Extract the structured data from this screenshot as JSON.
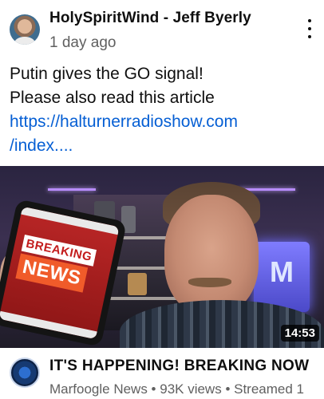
{
  "post": {
    "author": "HolySpiritWind - Jeff Byerly",
    "time_ago": "1 day ago",
    "text_line1": "Putin gives the GO signal!",
    "text_line2": "Please also read this article",
    "link_line1": "https://halturnerradioshow.com",
    "link_line2": "/index...."
  },
  "icons": {
    "more": "more-vert-icon",
    "avatar": "author-avatar",
    "channel_avatar": "channel-avatar"
  },
  "video": {
    "thumbnail_text_top": "BREAKING",
    "thumbnail_text_bottom": "NEWS",
    "panel_letter": "M",
    "duration": "14:53",
    "title": "IT'S HAPPENING! BREAKING NOW",
    "channel": "Marfoogle News",
    "views": "93K views",
    "status": "Streamed 1",
    "meta_separator": " • "
  },
  "colors": {
    "link": "#065fd4",
    "secondary_text": "#606060"
  }
}
